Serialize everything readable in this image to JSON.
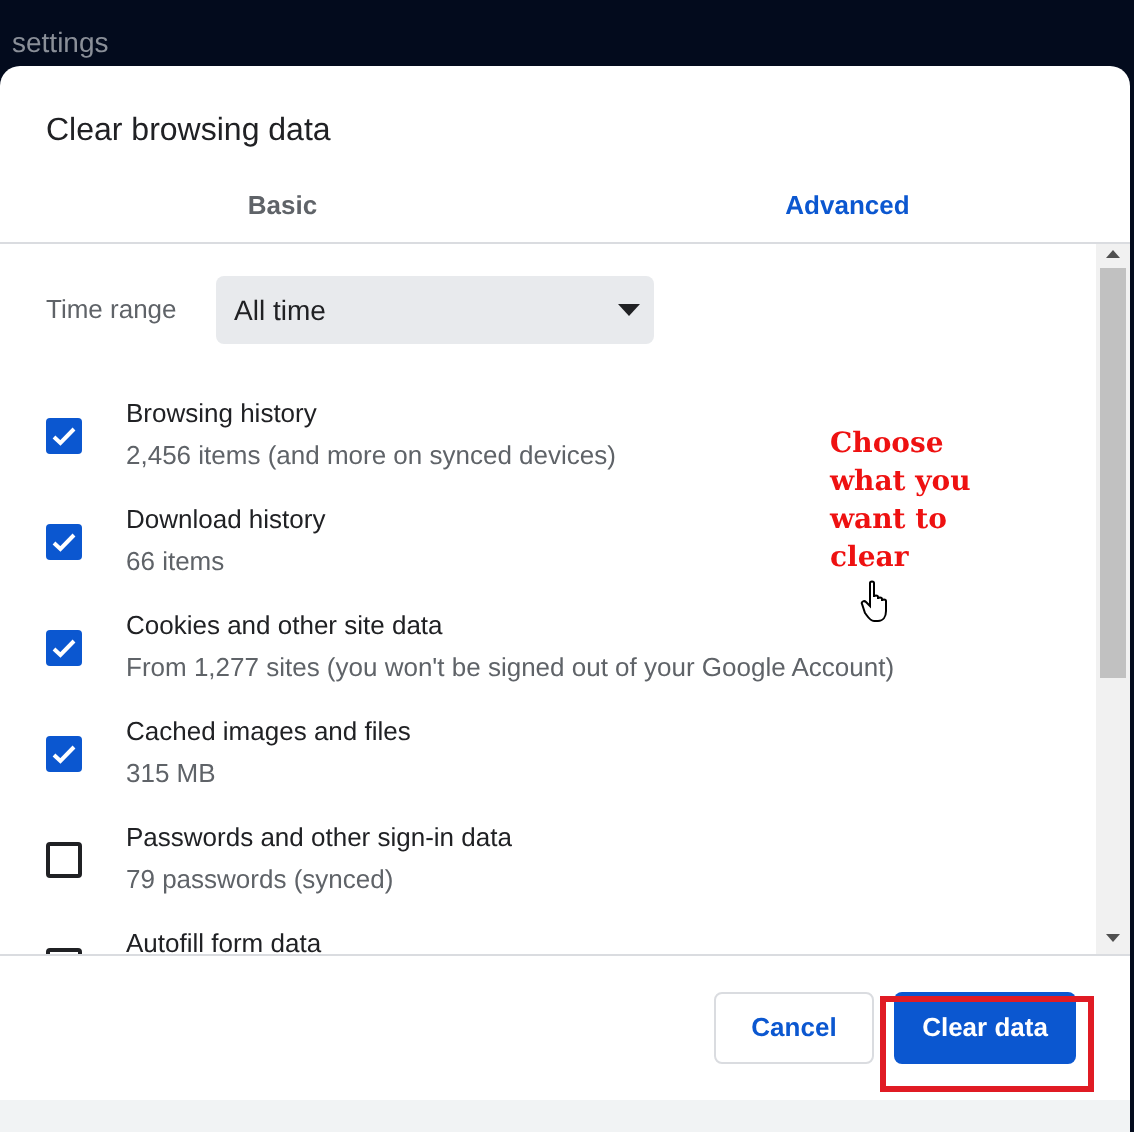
{
  "background": {
    "text": "settings"
  },
  "dialog": {
    "title": "Clear browsing data",
    "tabs": [
      {
        "label": "Basic",
        "selected": false
      },
      {
        "label": "Advanced",
        "selected": true
      }
    ],
    "time_range": {
      "label": "Time range",
      "value": "All time"
    },
    "items": [
      {
        "title": "Browsing history",
        "detail": "2,456 items (and more on synced devices)",
        "checked": true
      },
      {
        "title": "Download history",
        "detail": "66 items",
        "checked": true
      },
      {
        "title": "Cookies and other site data",
        "detail": "From 1,277 sites (you won't be signed out of your Google Account)",
        "checked": true
      },
      {
        "title": "Cached images and files",
        "detail": "315 MB",
        "checked": true
      },
      {
        "title": "Passwords and other sign-in data",
        "detail": "79 passwords (synced)",
        "checked": false
      },
      {
        "title": "Autofill form data",
        "checked": false
      }
    ],
    "buttons": [
      {
        "label": "Cancel",
        "kind": "secondary"
      },
      {
        "label": "Clear data",
        "kind": "primary"
      }
    ]
  },
  "annotation": {
    "text": "Choose what you want to clear"
  }
}
